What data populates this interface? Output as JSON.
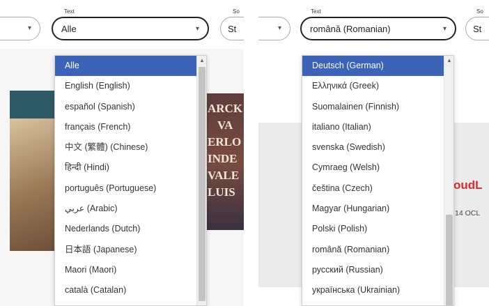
{
  "left": {
    "text_label": "Text",
    "text_select_value": "Alle",
    "neighbor_select_value": "",
    "next_label": "So",
    "next_select_value": "St",
    "options": [
      "Alle",
      "English (English)",
      "español (Spanish)",
      "français (French)",
      "中文 (繁體) (Chinese)",
      "हिन्दी (Hindi)",
      "português (Portuguese)",
      "عربي (Arabic)",
      "Nederlands (Dutch)",
      "日本語 (Japanese)",
      "Maori (Maori)",
      "català (Catalan)"
    ],
    "selected_index": 0,
    "scroll_position": 0.0,
    "book_text": [
      "ARCK",
      "VA",
      "ERLO",
      "INDE",
      "VALE",
      "LUIS"
    ]
  },
  "right": {
    "text_label": "Text",
    "text_select_value": "română (Romanian)",
    "neighbor_select_value": "",
    "next_label": "So",
    "next_select_value": "St",
    "options": [
      "Deutsch (German)",
      "Ελληνικά (Greek)",
      "Suomalainen (Finnish)",
      "italiano (Italian)",
      "svenska (Swedish)",
      "Cymraeg (Welsh)",
      "čeština (Czech)",
      "Magyar (Hungarian)",
      "Polski (Polish)",
      "română (Romanian)",
      "русский (Russian)",
      "українська (Ukrainian)"
    ],
    "selected_index": 0,
    "scroll_position": 0.6,
    "card_title_fragment": "oudL",
    "card_date_fragment": "14 OCL"
  },
  "colors": {
    "selection": "#3b63b8",
    "accent_red": "#e0262f"
  },
  "icons": [
    "chevron-down-icon",
    "scroll-up-arrow-icon"
  ]
}
